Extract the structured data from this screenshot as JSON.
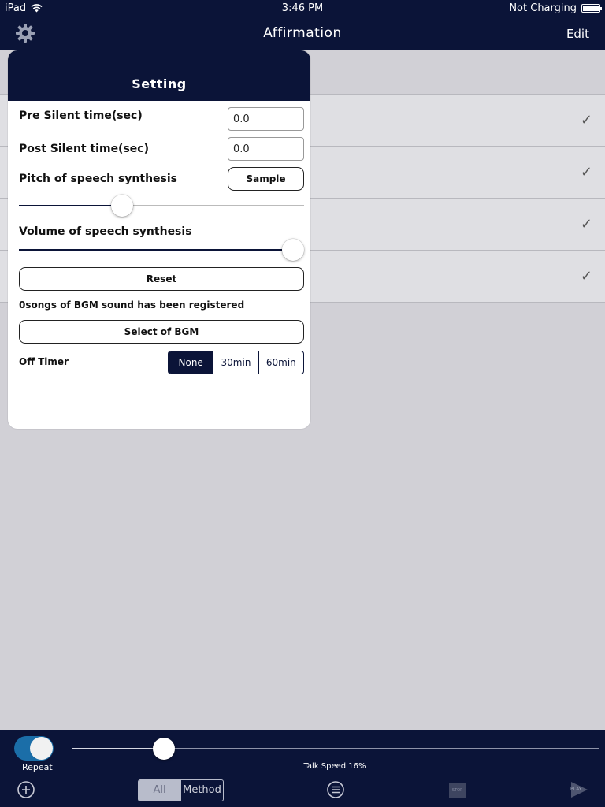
{
  "status_bar": {
    "device": "iPad",
    "time": "3:46 PM",
    "charging": "Not Charging"
  },
  "nav": {
    "title": "Affirmation",
    "edit_label": "Edit"
  },
  "list": {
    "rows": 4
  },
  "settings": {
    "title": "Setting",
    "pre_silent_label": "Pre Silent time(sec)",
    "pre_silent_value": "0.0",
    "post_silent_label": "Post Silent time(sec)",
    "post_silent_value": "0.0",
    "pitch_label": "Pitch of speech synthesis",
    "sample_label": "Sample",
    "pitch_level": 0.35,
    "volume_label": "Volume of speech synthesis",
    "volume_level": 1.0,
    "reset_label": "Reset",
    "bgm_note": "0songs of BGM sound has been registered",
    "select_bgm_label": "Select of BGM",
    "off_timer_label": "Off Timer",
    "off_timer_options": [
      "None",
      "30min",
      "60min"
    ],
    "off_timer_selected": "None"
  },
  "toolbar": {
    "repeat_label": "Repeat",
    "repeat_on": true,
    "talk_speed_label": "Talk Speed 16%",
    "talk_speed": 0.16,
    "filter_options": [
      "All",
      "Method"
    ],
    "filter_selected": "All",
    "stop_label": "STOP",
    "play_label": "PLAY"
  },
  "colors": {
    "navy": "#0b1438",
    "toggle_on": "#1b6ea8",
    "background": "#d1d0d6"
  }
}
